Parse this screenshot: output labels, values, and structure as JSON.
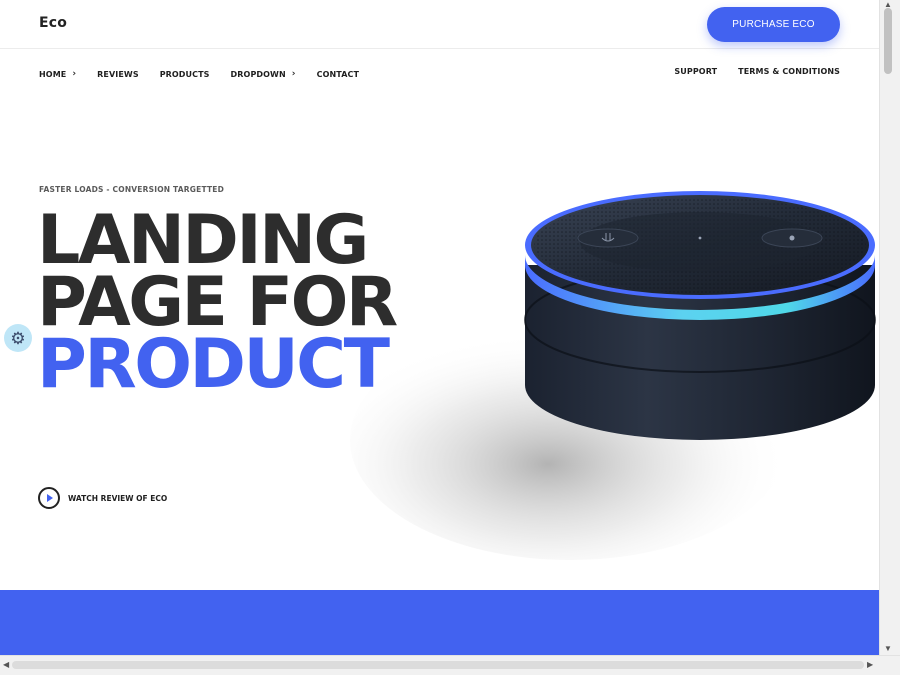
{
  "header": {
    "logo": "Eco",
    "purchase_button": "PURCHASE ECO"
  },
  "nav": {
    "left": [
      {
        "label": "HOME",
        "has_chevron": true
      },
      {
        "label": "REVIEWS",
        "has_chevron": false
      },
      {
        "label": "PRODUCTS",
        "has_chevron": false
      },
      {
        "label": "DROPDOWN",
        "has_chevron": true
      },
      {
        "label": "CONTACT",
        "has_chevron": false
      }
    ],
    "right": [
      {
        "label": "SUPPORT"
      },
      {
        "label": "TERMS & CONDITIONS"
      }
    ],
    "chevron_glyph": "›"
  },
  "hero": {
    "tagline": "FASTER LOADS - CONVERSION TARGETTED",
    "headline_line1": "LANDING",
    "headline_line2": "PAGE FOR",
    "headline_accent": "PRODUCT",
    "watch_label": "WATCH REVIEW OF ECO"
  },
  "icons": {
    "settings": "gear-icon",
    "play": "play-icon"
  },
  "colors": {
    "accent": "#4262f0",
    "text_dark": "#2d2d2d",
    "settings_bg": "#bfe6f7",
    "device_ring": "#4a6cff",
    "device_glow": "#4fd8e8"
  }
}
